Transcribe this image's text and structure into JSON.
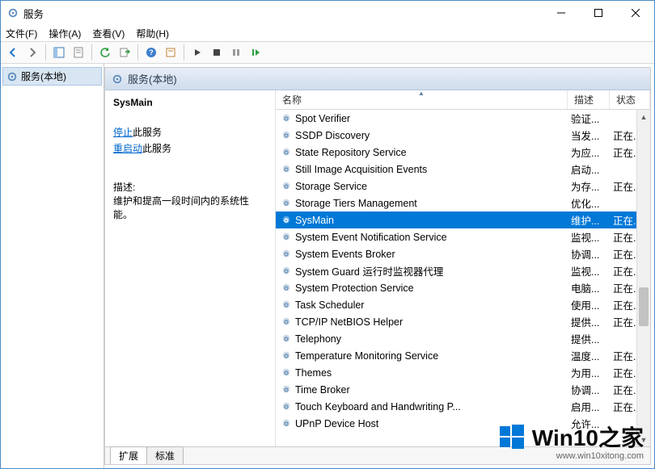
{
  "window": {
    "title": "服务"
  },
  "menu": {
    "file": "文件(F)",
    "action": "操作(A)",
    "view": "查看(V)",
    "help": "帮助(H)"
  },
  "tree": {
    "root": "服务(本地)"
  },
  "content_header": "服务(本地)",
  "detail": {
    "service_name": "SysMain",
    "stop_link": "停止",
    "stop_suffix": "此服务",
    "restart_link": "重启动",
    "restart_suffix": "此服务",
    "desc_label": "描述:",
    "desc_text": "维护和提高一段时间内的系统性能。"
  },
  "columns": {
    "name": "名称",
    "desc": "描述",
    "status": "状态"
  },
  "services": [
    {
      "name": "Spot Verifier",
      "desc": "验证...",
      "status": ""
    },
    {
      "name": "SSDP Discovery",
      "desc": "当发...",
      "status": "正在..."
    },
    {
      "name": "State Repository Service",
      "desc": "为应...",
      "status": "正在..."
    },
    {
      "name": "Still Image Acquisition Events",
      "desc": "启动...",
      "status": ""
    },
    {
      "name": "Storage Service",
      "desc": "为存...",
      "status": "正在..."
    },
    {
      "name": "Storage Tiers Management",
      "desc": "优化...",
      "status": ""
    },
    {
      "name": "SysMain",
      "desc": "维护...",
      "status": "正在...",
      "selected": true
    },
    {
      "name": "System Event Notification Service",
      "desc": "监视...",
      "status": "正在..."
    },
    {
      "name": "System Events Broker",
      "desc": "协调...",
      "status": "正在..."
    },
    {
      "name": "System Guard 运行时监视器代理",
      "desc": "监视...",
      "status": "正在..."
    },
    {
      "name": "System Protection Service",
      "desc": "电脑...",
      "status": "正在..."
    },
    {
      "name": "Task Scheduler",
      "desc": "使用...",
      "status": "正在..."
    },
    {
      "name": "TCP/IP NetBIOS Helper",
      "desc": "提供...",
      "status": "正在..."
    },
    {
      "name": "Telephony",
      "desc": "提供...",
      "status": ""
    },
    {
      "name": "Temperature Monitoring Service",
      "desc": "温度...",
      "status": "正在..."
    },
    {
      "name": "Themes",
      "desc": "为用...",
      "status": "正在..."
    },
    {
      "name": "Time Broker",
      "desc": "协调...",
      "status": "正在..."
    },
    {
      "name": "Touch Keyboard and Handwriting P...",
      "desc": "启用...",
      "status": "正在..."
    },
    {
      "name": "UPnP Device Host",
      "desc": "允许...",
      "status": ""
    }
  ],
  "tabs": {
    "extended": "扩展",
    "standard": "标准"
  },
  "watermark": {
    "main": "Win10之家",
    "sub": "www.win10xitong.com"
  }
}
